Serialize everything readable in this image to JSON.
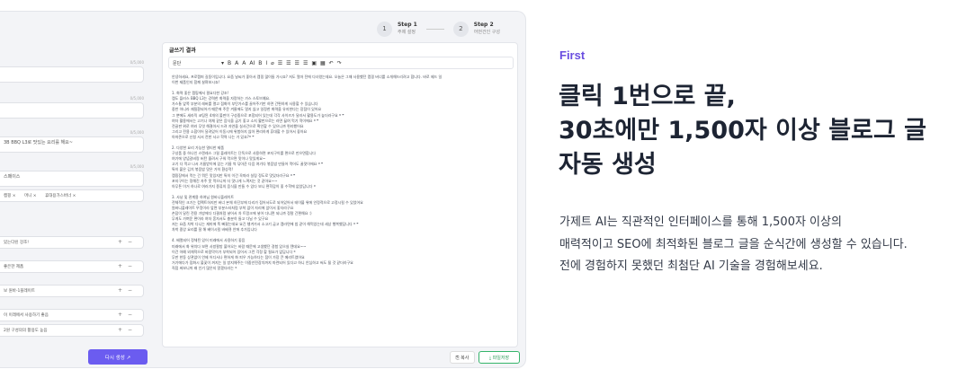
{
  "steps": [
    {
      "num": "1",
      "title": "Step 1",
      "sub": "주제 설정"
    },
    {
      "num": "2",
      "title": "Step 2",
      "sub": "어떤건인 구성"
    }
  ],
  "left_panel": {
    "counters": [
      "0/5,000",
      "0/5,000",
      "0/5,000",
      "0/5,000"
    ],
    "field_texts": [
      "",
      "",
      "3B BBQ L3로 맛있는 요리를 해요~",
      "스페이스"
    ],
    "chips": [
      "캠핑 ×",
      "머니 ×",
      "휴대용가스버너 ×"
    ],
    "rows": [
      "있는다린 강조!",
      "좋은한 제품",
      "보 원바-1플레이트",
      "이 이래에서 사용하기 좋음",
      "2원 구성의의 활용도 높음"
    ]
  },
  "editor": {
    "title": "글쓰기 결과",
    "paragraph_select": "문단",
    "toolbar_icons": [
      "▾",
      "B",
      "A",
      "A",
      "AI",
      "B",
      "I",
      "⌀",
      "☰",
      "☰",
      "☰",
      "☰",
      "▣",
      "▦",
      "↶",
      "↷"
    ],
    "lines": [
      "안녕하세요, 프로캠퍼 길동이입니다. 요즘 날씨가 좋아서 캠핑 많이들 가시죠? 저도 얼마 전에 다녀왔는데요. 오늘은 그때 사용했던 캠핑 버너를 소개해드리려고 합니다. 바로 제드 일",
      "이번 제품인지 함께 살펴보시죠!",
      "",
      "1. 화력 좋은 캠핑에서 필요다한 강조!",
      "캠도 플러스 BBQ L3는 강력한 화력을 자랑하는 가스 스토브예요.",
      "가스통 앞쪽 부분의 레버를 열고 점화이 부탄가스를 끌어주기만 하면 간편하게 사용할 수 있습니다",
      "중반 아니라 재질환되어가 때문에 주문 겨울에도 얼지 않고 일정한 화력을 유지한다는 장점이 있어요",
      "그 뿐에도 세라믹 코팅된 4개의 볼판이 구성중으로 포함되어 있는데 각각 사이즈가 달라서 활용도가 높더라구요 ❝ ❞",
      "여자 활용에서는 고기나 야채 같은 음식을 굽기 좋고 소지 활판으로는 라면 끓여 먹기 딱이에요 ❝ ❞",
      "전골판 위로 여러 무엇 해결아서 드려 자연을 실사간으로 확인할 수 있으니까 편리했어요",
      "그리고 전용 소합이어 달려있어 이동시에 위험하지 않아 편리하게 휴대할 수 있어서 좋아요",
      "아마존으로 신청 서서 전한 사고 학력 나는 거 있죠?❝ ❞",
      "",
      "2. 다양한 요리 가능한 멀티한 제품",
      "구성품 중 하나인 스텐레스 그릴 플레이트는 단독으로 사용하면 포지구이를 편으로 만으면합니다",
      "여기에 양념갈비랑 버턴 올려서 구워 먹으면 맛이나 맛있게요~",
      "고기 다 먹고 나서 기름받이에 있는 기름 싹 닦아준 다음 여기다 볶음밥 만들어 먹어도 꿀맛이에요 ❝ ❞",
      "특히 붙은 김치 볶음밥 맛은 가히 환상적!",
      "캠핑장에서 먹는 건 뭐든 맛있지만 특히 이건 꼭따라 실링 정도로 맛있더라구요 ❝ ❞",
      "포지구이는 정해진 자주 못 먹으니까 더 맛나게 느껴지는 것 같아요~~",
      "아무튼 이거 하나로 여러가지 종류의 음식을 만들 수 있다 보니 편학감이 좋 수학에 없었답니다 ❝",
      "",
      "3. 사낭 및 관계용 하여님 원바니플레이트",
      "전체적인 크기는 컴팩트하지만 버너 본체 하단부에 다리가 접어서도로 되어있어서 테이블 위에 안정적으로 고정시킬 수 있었어요",
      "원바니플레이트 뚜껑이라 앞면 부분스타처럼 부착 없이 자리에 앉이서 좋더라구요",
      "손잡이 달린 전용 가방에다 다결처럼 넣어서 차 트렁크에 넣어 다니면 되니까 정말 간편해요 :)",
      "무게도 가벼운 편이라 여자 혼자서도 충분히 들고 다닐 수 있구요",
      "저는 요즘 차박 다니는 재미에 푹 빠졌는데요 요긴 챙겨가서 소고기 굽고 캠라면에 밥 같이 해먹었는데 세상 행복했답니다 ❝ ❞",
      "차박 중앙 요리를 잘 해 베이시킬 바베큐 안에 추가입니다",
      "",
      "4. 배열되어 정체된 있어 미래에서 사용하기 좋음",
      "미래에서 화 위치다 보면 사방팔방 불어오는 바람 때문에 고생했던 경험 있으실 텐데요~~",
      "이건 아예 외체적으로 바람막이가 부착되어 있어서 그런 걱정 할 필요가 없답니다 ❝",
      "무판 한동 상관없이 언제 어디서나 편하게 화 피우 가능하다는 점이 가장 큰 메리트였어요",
      "거기에다가 접화시 불꽃이 꺼지는 일 방지해주는 이중안전장치까지 마련되어 있다고 하니 안심하고 써도 될 것 같더라구요",
      "직접 써보니까 왜 인기 많은지 알겠더라는 ❝"
    ],
    "regen_label": "다시 생성 ↗",
    "copy_label": "⎘ 복사",
    "save_label": "⤓ 파일저장"
  },
  "marketing": {
    "eyebrow": "First",
    "headline": [
      "클릭 1번으로 끝,",
      "30초에만 1,500자 이상 블로그 글",
      "자동 생성"
    ],
    "description": [
      "가제트 AI는 직관적인 인터페이스를 통해 1,500자 이상의",
      "매력적이고 SEO에 최적화된 블로그 글을 순식간에 생성할 수 있습니다.",
      "전에 경험하지 못했던 최첨단 AI 기술을 경험해보세요."
    ]
  },
  "colors": {
    "accent": "#6a4ee0",
    "button": "#6b5cf0",
    "save_green": "#2f9e5c",
    "headline": "#1d2433"
  }
}
